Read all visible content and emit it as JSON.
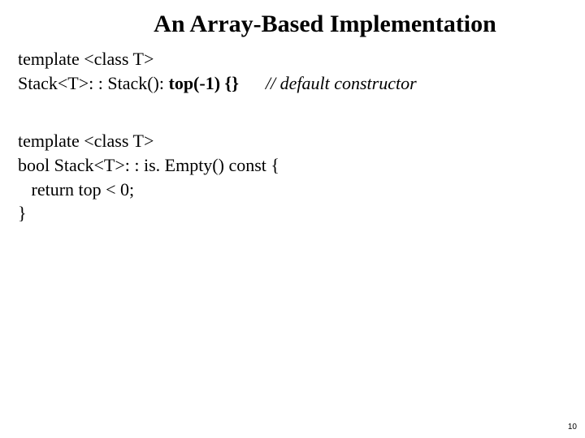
{
  "title": "An Array-Based Implementation",
  "block1": {
    "line1": "template <class T>",
    "line2a": "Stack<T>: : Stack(): ",
    "line2b": "top(-1) {}",
    "line2spacer": "      ",
    "line2c": "// default constructor"
  },
  "block2": {
    "line1": "template <class T>",
    "line2": "bool Stack<T>: : is. Empty() const {",
    "line3": "   return top < 0;",
    "line4": "}"
  },
  "page_number": "10"
}
